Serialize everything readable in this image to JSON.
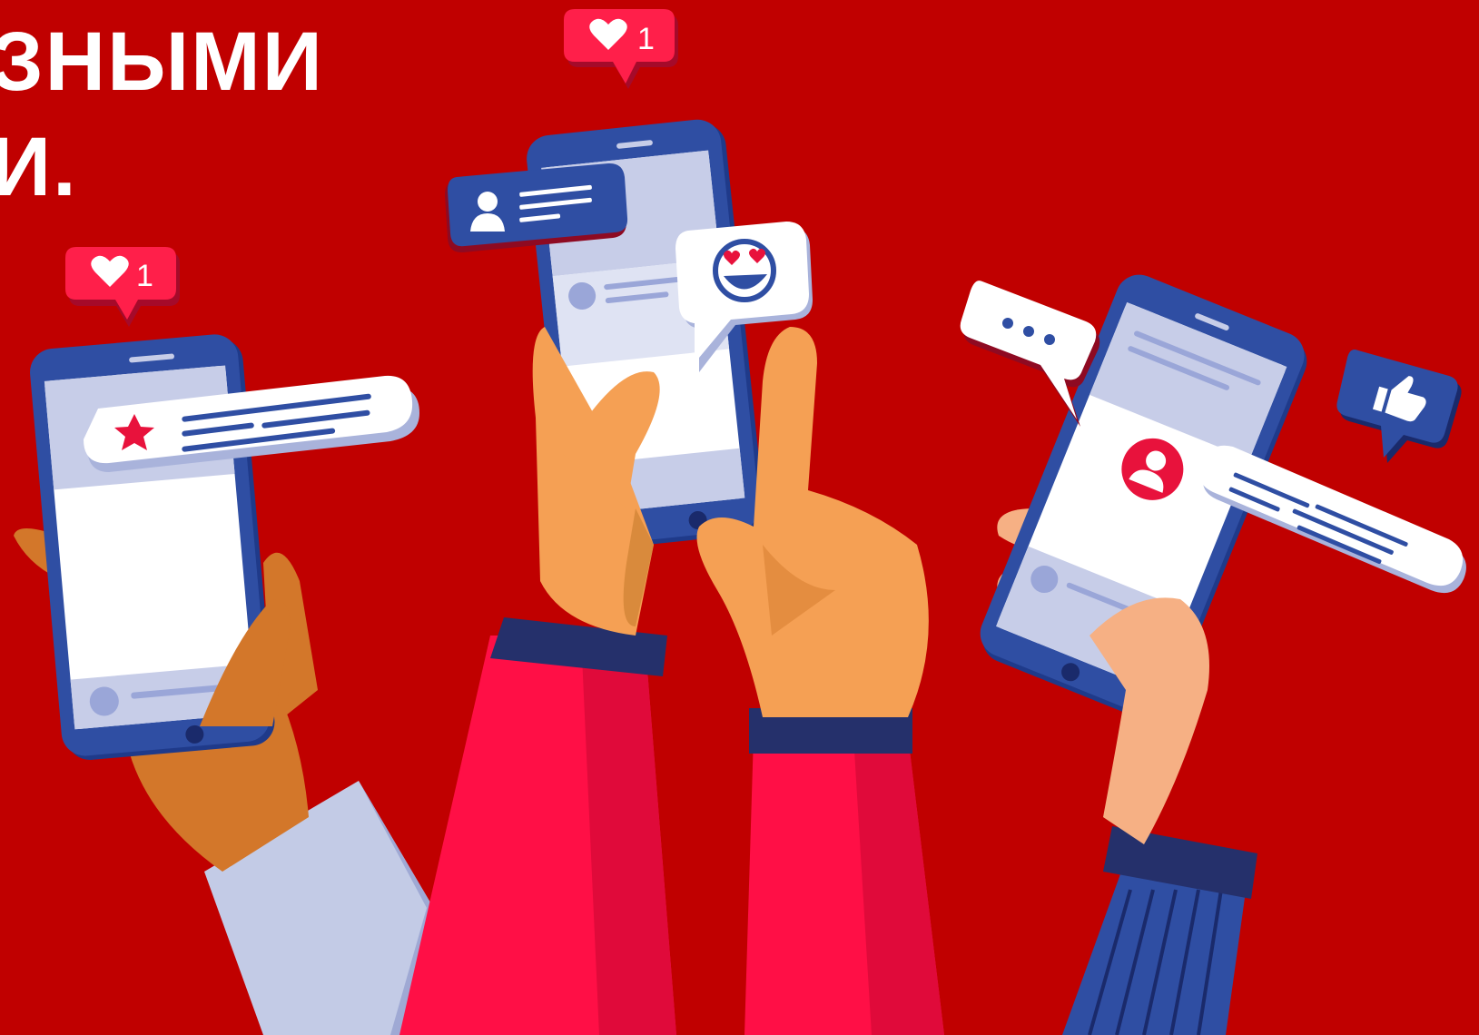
{
  "headline": {
    "line1": "ЗНЫМИ",
    "line2": "И."
  },
  "badges": {
    "like_count_left": "1",
    "like_count_center": "1"
  },
  "colors": {
    "background": "#c00000",
    "phone_blue": "#2f4ea3",
    "screen_light": "#c7cde8",
    "badge_red": "#ff1f4a",
    "skin_orange": "#f5a054",
    "skin_dark": "#d3772a",
    "skin_light": "#f6b084",
    "sleeve_red": "#ff0f46",
    "sleeve_gray": "#c3cbe6",
    "sleeve_navy": "#25306b"
  },
  "icons": [
    "heart-icon",
    "star-icon",
    "user-icon",
    "smiley-heart-eyes-icon",
    "ellipsis-icon",
    "thumbs-up-icon",
    "profile-avatar-icon"
  ]
}
